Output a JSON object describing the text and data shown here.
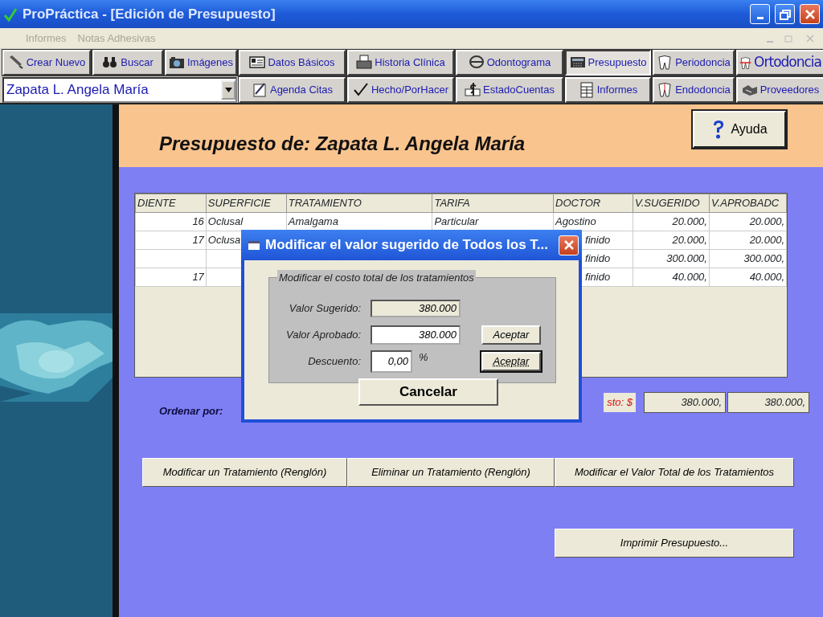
{
  "window": {
    "title": "ProPráctica - [Edición de Presupuesto]"
  },
  "menu": [
    "Informes",
    "Notas Adhesivas"
  ],
  "toolbar": {
    "row1": [
      {
        "label": "Crear Nuevo",
        "selected": false
      },
      {
        "label": "Buscar",
        "selected": false
      },
      {
        "label": "Imágenes",
        "selected": false
      },
      {
        "label": "Datos Básicos",
        "selected": false
      },
      {
        "label": "Historia Clínica",
        "selected": false
      },
      {
        "label": "Odontograma",
        "selected": false
      },
      {
        "label": "Presupuesto",
        "selected": true
      },
      {
        "label": "Periodoncia",
        "selected": false
      },
      {
        "label": "Ortodoncia",
        "selected": false
      }
    ],
    "patient": {
      "value": "Zapata L. Angela María"
    },
    "row2": [
      {
        "label": "Agenda Citas",
        "selected": false
      },
      {
        "label": "Hecho/PorHacer",
        "selected": false
      },
      {
        "label": "EstadoCuentas",
        "selected": false
      },
      {
        "label": "Informes",
        "selected": false
      },
      {
        "label": "Endodoncia",
        "selected": false
      },
      {
        "label": "Proveedores",
        "selected": false
      }
    ]
  },
  "header": {
    "title": "Presupuesto de: Zapata L. Angela María",
    "help_button": "Ayuda"
  },
  "table": {
    "columns": [
      "DIENTE",
      "SUPERFICIE",
      "TRATAMIENTO",
      "TARIFA",
      "DOCTOR",
      "V.SUGERIDO",
      "V.APROBADC"
    ],
    "rows": [
      [
        "16",
        "Oclusal",
        "Amalgama",
        "Particular",
        "Agostino",
        "20.000,",
        "20.000,"
      ],
      [
        "17",
        "Oclusa",
        "",
        "",
        "finido",
        "20.000,",
        "20.000,"
      ],
      [
        "",
        "",
        "",
        "",
        "finido",
        "300.000,",
        "300.000,"
      ],
      [
        "17",
        "",
        "",
        "",
        "finido",
        "40.000,",
        "40.000,"
      ]
    ]
  },
  "totals": {
    "label": "sto: $",
    "values": [
      "380.000,",
      "380.000,"
    ]
  },
  "sort_label": "Ordenar por:",
  "actions": [
    "Modificar un Tratamiento (Renglón)",
    "Eliminar un Tratamiento (Renglón)",
    "Modificar el Valor Total de los Tratamientos"
  ],
  "print_button": "Imprimir Presupuesto...",
  "dialog": {
    "title": "Modificar el valor sugerido de Todos los T...",
    "group_title": "Modificar el costo total de los tratamientos",
    "fields": [
      {
        "label": "Valor Sugerido:",
        "value": "380.000",
        "kind": "readonly"
      },
      {
        "label": "Valor Aprobado:",
        "value": "380.000",
        "kind": "input"
      },
      {
        "label": "Descuento:",
        "value": "0,00",
        "kind": "input",
        "unit": "%"
      }
    ],
    "accept_buttons": [
      {
        "label": "Aceptar",
        "focused": false
      },
      {
        "label": "Aceptar",
        "focused": true
      }
    ],
    "cancel_button": "Cancelar"
  }
}
